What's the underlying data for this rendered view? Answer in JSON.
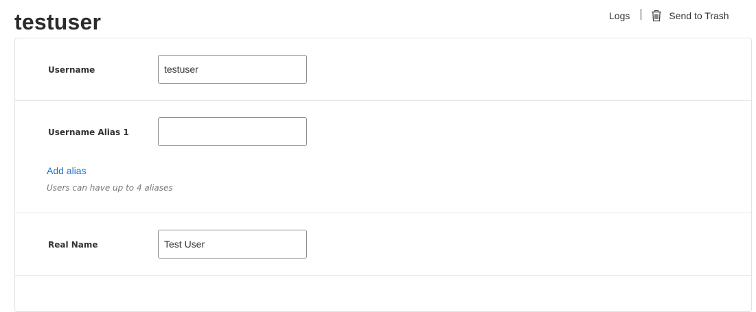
{
  "header": {
    "title": "testuser",
    "logs_label": "Logs",
    "trash_label": "Send to Trash"
  },
  "form": {
    "username": {
      "label": "Username",
      "value": "testuser"
    },
    "alias1": {
      "label": "Username Alias 1",
      "value": ""
    },
    "add_alias_label": "Add alias",
    "alias_help": "Users can have up to 4 aliases",
    "real_name": {
      "label": "Real Name",
      "value": "Test User"
    }
  },
  "colors": {
    "link": "#1a73c8",
    "border": "#e2e2e2",
    "input_border": "#8a8a8a"
  },
  "icons": {
    "trash": "trash-icon"
  }
}
